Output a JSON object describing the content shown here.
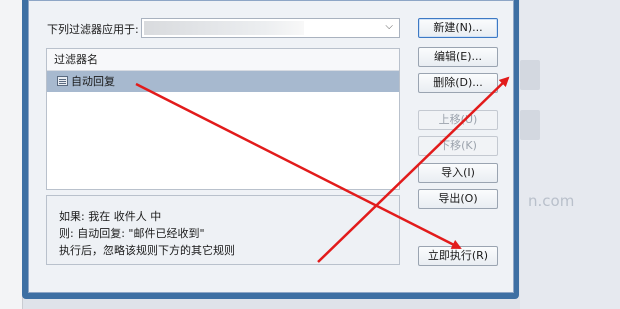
{
  "dialog": {
    "apply_label": "下列过滤器应用于:",
    "list_header": "过滤器名",
    "rules": [
      {
        "name": "自动回复"
      }
    ],
    "description": [
      "如果: 我在 收件人 中",
      "则: 自动回复: \"邮件已经收到\"",
      "执行后，忽略该规则下方的其它规则"
    ],
    "buttons": {
      "new": "新建(N)...",
      "edit": "编辑(E)...",
      "delete": "删除(D)...",
      "move_up": "上移(U)",
      "move_down": "下移(K)",
      "import": "导入(I)",
      "export": "导出(O)",
      "run_now": "立即执行(R)"
    }
  },
  "background": {
    "watermark": "n.com"
  },
  "colors": {
    "frame": "#3d6fa3",
    "selection": "#a7b9cf",
    "arrow": "#e21b1b"
  }
}
